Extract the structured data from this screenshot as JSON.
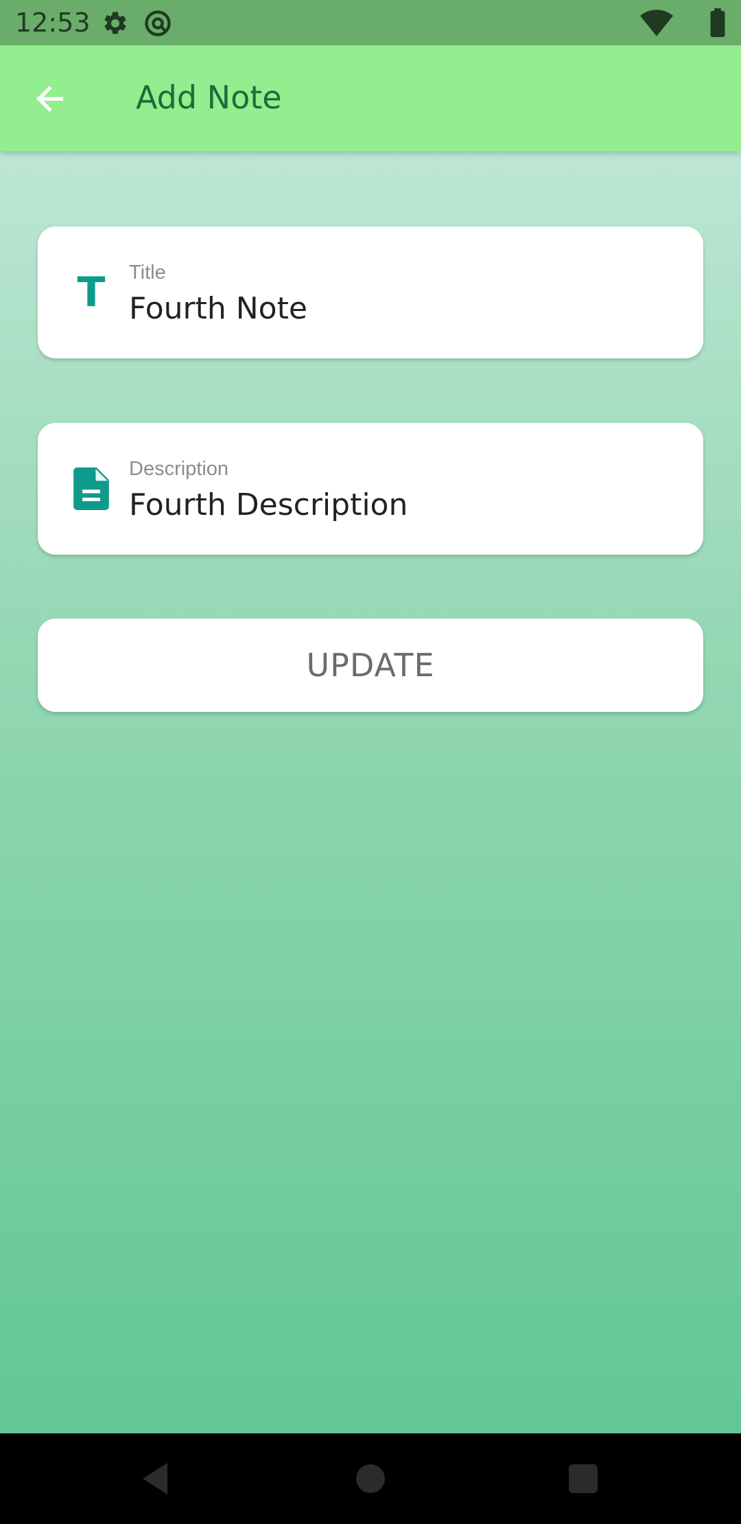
{
  "status_bar": {
    "time": "12:53",
    "icons": [
      "gear-icon",
      "at-sign-icon",
      "wifi-icon",
      "battery-icon"
    ]
  },
  "app_bar": {
    "title": "Add Note",
    "back_icon": "arrow-left-icon"
  },
  "form": {
    "title_field": {
      "label": "Title",
      "value": "Fourth Note",
      "icon": "title-t-icon"
    },
    "description_field": {
      "label": "Description",
      "value": "Fourth Description",
      "icon": "document-icon"
    },
    "update_button": {
      "label": "UPDATE"
    }
  },
  "nav_bar": {
    "icons": [
      "back-triangle-icon",
      "home-circle-icon",
      "recents-square-icon"
    ]
  },
  "colors": {
    "status_bar": "#6aad6a",
    "app_bar": "#92ee8e",
    "app_title": "#1f6a3a",
    "icon_accent": "#0f9a8c",
    "gradient_top": "#bde6d4",
    "gradient_bottom": "#62c695"
  }
}
